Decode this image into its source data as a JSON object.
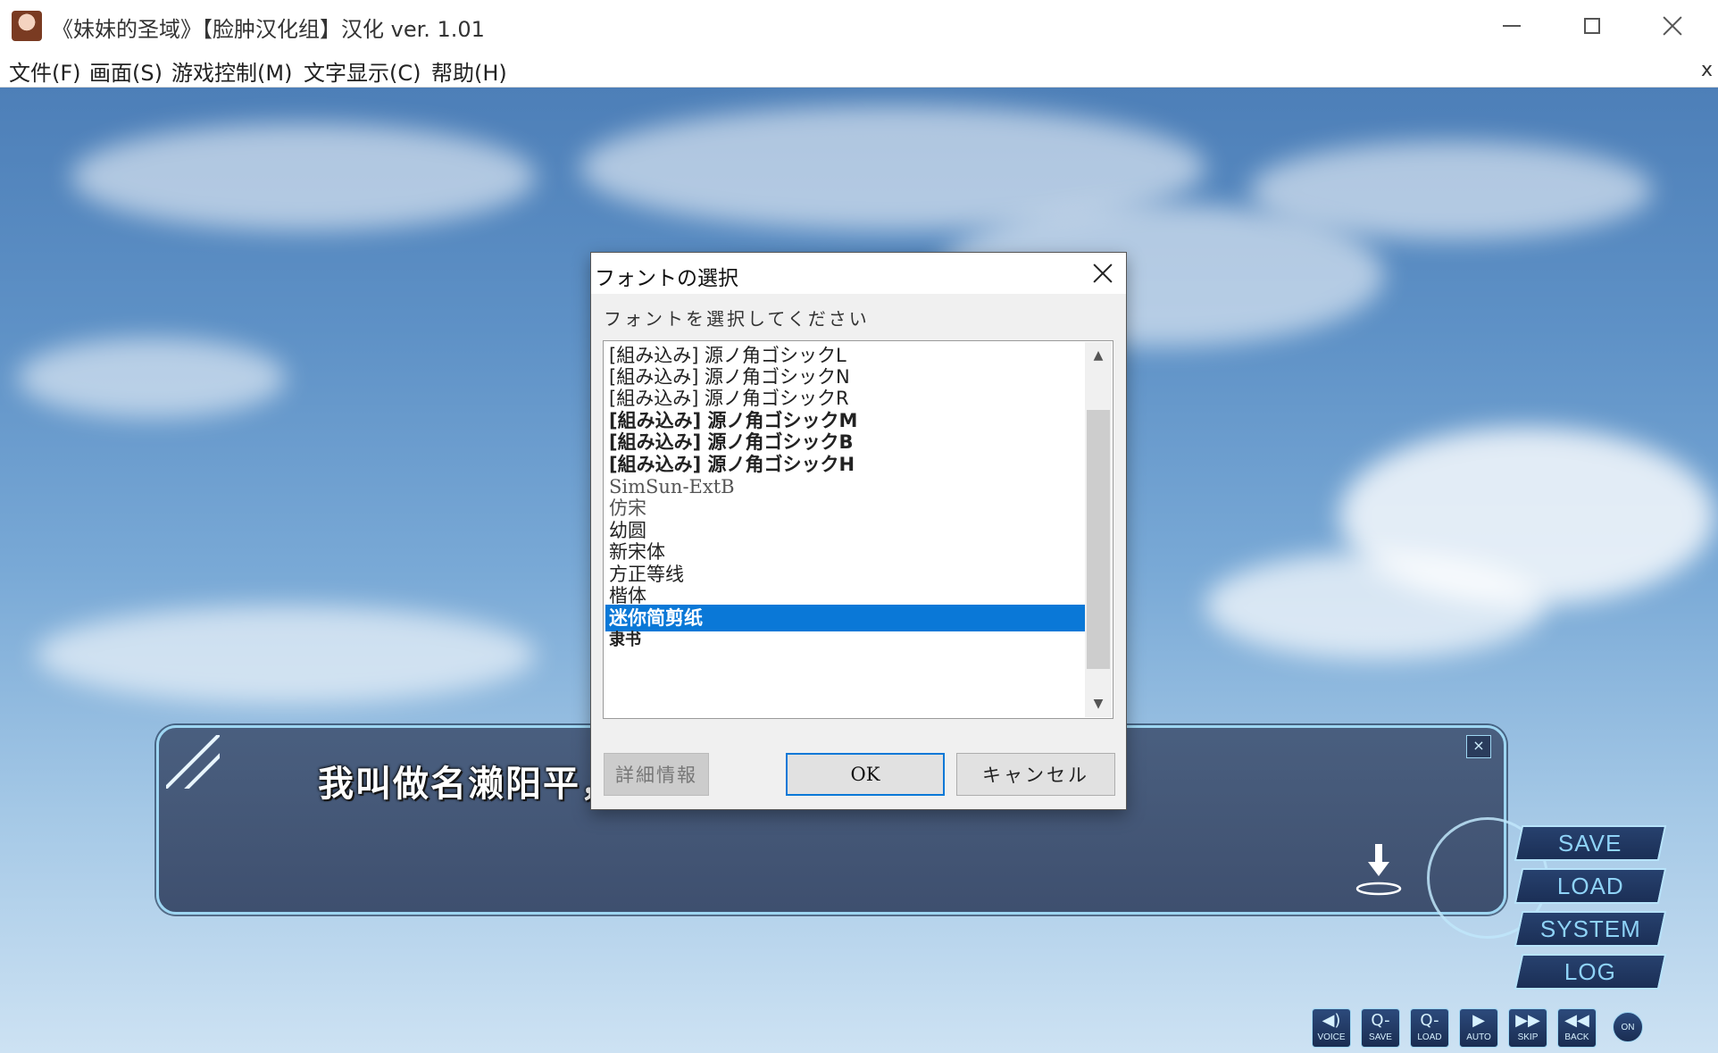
{
  "window": {
    "title": "《妹妹的圣域》【脸肿汉化组】汉化 ver. 1.01",
    "menu": [
      "文件(F)",
      "画面(S)",
      "游戏控制(M)",
      "文字显示(C)",
      "帮助(H)"
    ],
    "menu_close": "x"
  },
  "dialog": {
    "title": "フォントの選択",
    "prompt": "フォントを選択してください",
    "fonts": [
      "[組み込み] 源ノ角ゴシックL",
      "[組み込み] 源ノ角ゴシックN",
      "[組み込み] 源ノ角ゴシックR",
      "[組み込み] 源ノ角ゴシックM",
      "[組み込み] 源ノ角ゴシックB",
      "[組み込み] 源ノ角ゴシックH",
      "SimSun-ExtB",
      "仿宋",
      "幼圆",
      "新宋体",
      "方正等线",
      "楷体",
      "迷你简剪纸",
      "隶书"
    ],
    "selected_font": "迷你简剪纸",
    "buttons": {
      "details": "詳細情報",
      "ok": "OK",
      "cancel": "キャンセル"
    }
  },
  "message": {
    "text": "我叫做名濑阳平，是一名秋叶原系男生。",
    "close": "×"
  },
  "side_buttons": [
    "SAVE",
    "LOAD",
    "SYSTEM",
    "LOG"
  ],
  "quick_buttons": [
    {
      "icon": "voice-icon",
      "glyph": "◀)",
      "label": "VOICE"
    },
    {
      "icon": "quick-save-icon",
      "glyph": "Q-",
      "label": "SAVE"
    },
    {
      "icon": "quick-load-icon",
      "glyph": "Q-",
      "label": "LOAD"
    },
    {
      "icon": "auto-icon",
      "glyph": "▶",
      "label": "AUTO"
    },
    {
      "icon": "skip-icon",
      "glyph": "▶▶",
      "label": "SKIP"
    },
    {
      "icon": "back-icon",
      "glyph": "◀◀",
      "label": "BACK"
    },
    {
      "icon": "toggle-on-icon",
      "glyph": "",
      "label": "ON"
    }
  ],
  "colors": {
    "selection": "#0a78d7",
    "msg_border": "#9ed6f2",
    "side_button_text": "#8fd3f7"
  }
}
